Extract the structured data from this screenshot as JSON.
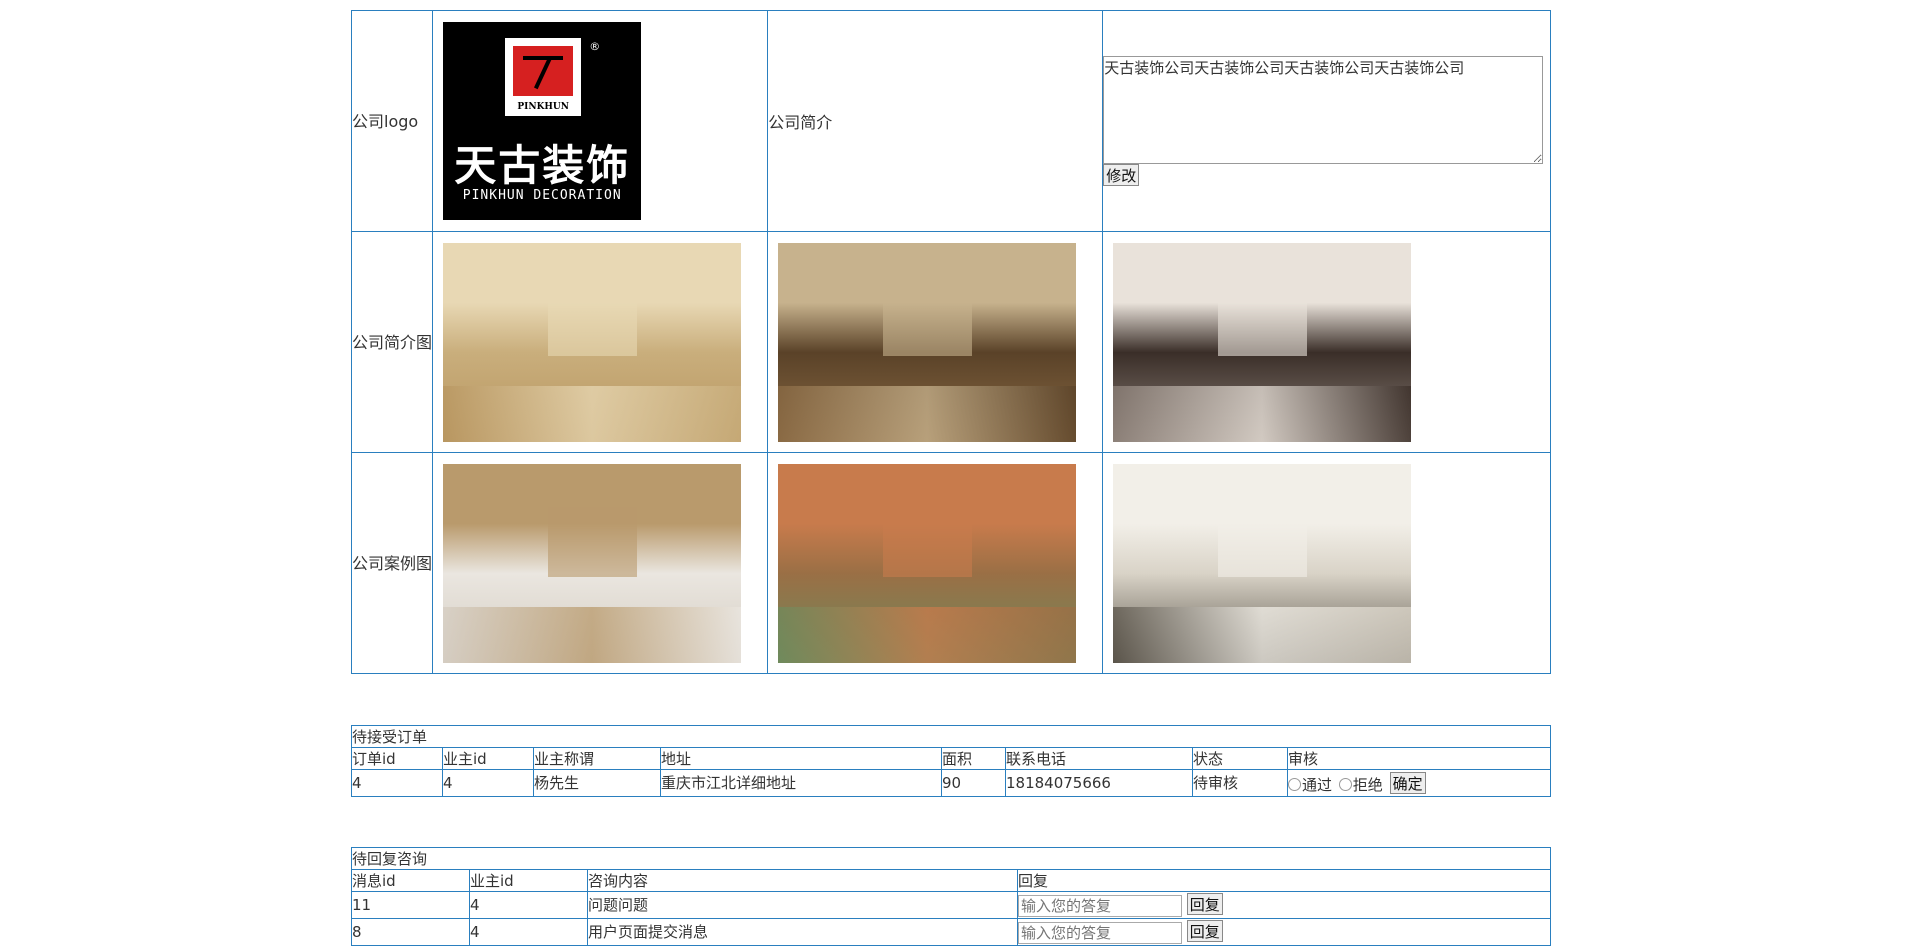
{
  "company": {
    "logo_label": "公司logo",
    "logo": {
      "mark": "PINKHUN",
      "registered": "®",
      "name_cn": "天古装饰",
      "name_en": "PINKHUN DECORATION"
    },
    "intro_label": "公司简介",
    "intro_text": "天古装饰公司天古装饰公司天古装饰公司天古装饰公司",
    "modify_button": "修改",
    "intro_images_label": "公司简介图",
    "intro_images": [
      {
        "scene": "bathroom",
        "colors": [
          "#c9ae7c",
          "#e8d8b4",
          "#b89660"
        ]
      },
      {
        "scene": "living-room",
        "colors": [
          "#5a4228",
          "#c7b28d",
          "#8a6a44"
        ]
      },
      {
        "scene": "tv-living-room",
        "colors": [
          "#3a2e28",
          "#e9e2da",
          "#8c8078"
        ]
      }
    ],
    "case_images_label": "公司案例图",
    "case_images": [
      {
        "scene": "bright-living-room",
        "colors": [
          "#eae6e0",
          "#b99a6c",
          "#d5cdc2"
        ]
      },
      {
        "scene": "garden-lounge",
        "colors": [
          "#9a6f45",
          "#c87b4c",
          "#6f8a5c"
        ]
      },
      {
        "scene": "modern-lounge",
        "colors": [
          "#d9d3c7",
          "#f2efe8",
          "#5a544a"
        ]
      }
    ]
  },
  "orders": {
    "title": "待接受订单",
    "headers": [
      "订单id",
      "业主id",
      "业主称谓",
      "地址",
      "面积",
      "联系电话",
      "状态",
      "审核"
    ],
    "rows": [
      {
        "order_id": "4",
        "owner_id": "4",
        "owner_name": "杨先生",
        "address": "重庆市江北详细地址",
        "area": "90",
        "phone": "18184075666",
        "status": "待审核"
      }
    ],
    "approve_label": "通过",
    "reject_label": "拒绝",
    "confirm_button": "确定"
  },
  "messages": {
    "title": "待回复咨询",
    "headers": [
      "消息id",
      "业主id",
      "咨询内容",
      "回复"
    ],
    "rows": [
      {
        "msg_id": "11",
        "owner_id": "4",
        "content": "问题问题"
      },
      {
        "msg_id": "8",
        "owner_id": "4",
        "content": "用户页面提交消息"
      }
    ],
    "reply_placeholder": "输入您的答复",
    "reply_button": "回复"
  },
  "colors": {
    "border": "#2a7fbf"
  }
}
